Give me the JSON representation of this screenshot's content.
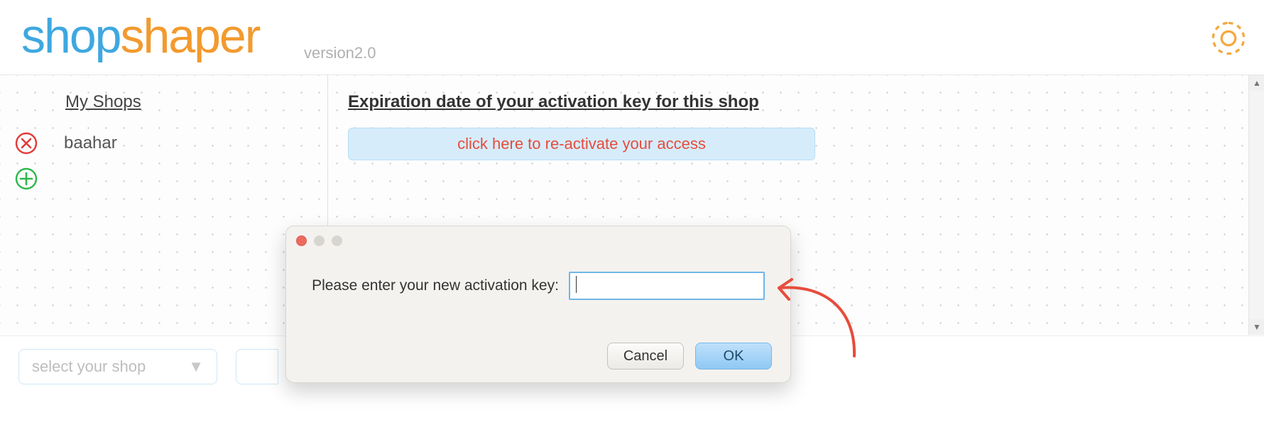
{
  "app": {
    "logo_shop": "shop",
    "logo_shaper": "shaper",
    "version": "version2.0"
  },
  "sidebar": {
    "heading": "My Shops",
    "shops": [
      {
        "name": "baahar"
      }
    ]
  },
  "content": {
    "heading": "Expiration date of your activation key for this shop",
    "reactivate_label": "click here to re-activate your access"
  },
  "bottom": {
    "select_placeholder": "select your shop"
  },
  "dialog": {
    "prompt": "Please enter your new activation key:",
    "input_value": "",
    "cancel": "Cancel",
    "ok": "OK"
  }
}
